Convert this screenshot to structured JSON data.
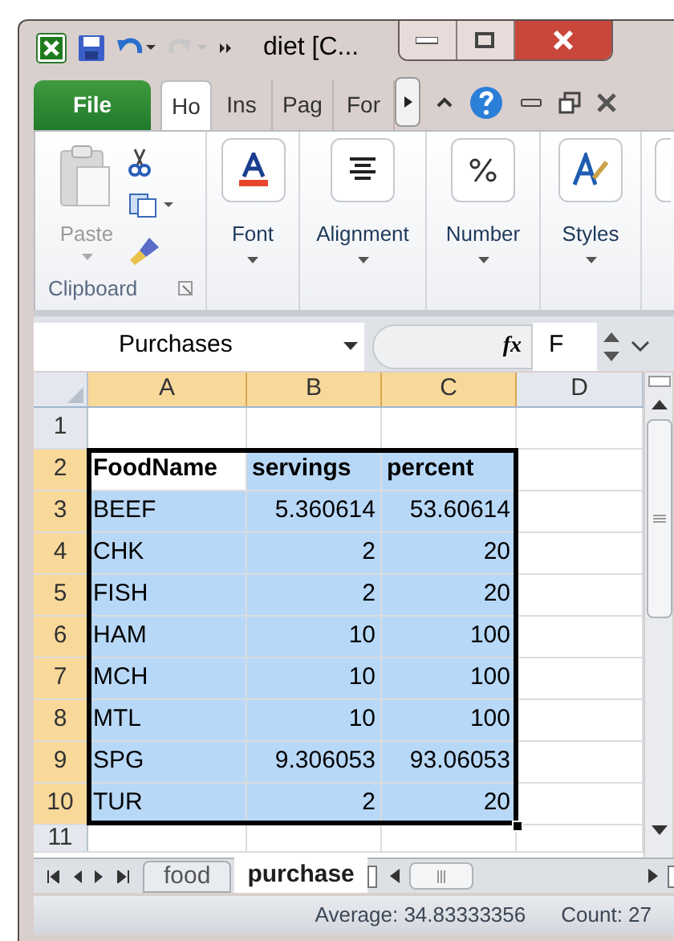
{
  "title_bar": {
    "title": "diet  [C..."
  },
  "ribbon_tabs": [
    {
      "label": "File",
      "kind": "file",
      "selected": false
    },
    {
      "label": "Ho",
      "kind": "tab",
      "selected": true
    },
    {
      "label": "Ins",
      "kind": "tab",
      "selected": false
    },
    {
      "label": "Pag",
      "kind": "tab",
      "selected": false
    },
    {
      "label": "For",
      "kind": "tab",
      "selected": false
    }
  ],
  "clipboard": {
    "paste": {
      "label": "Paste",
      "disabled": true
    },
    "group_label": "Clipboard"
  },
  "ribbon_groups": [
    {
      "label": "Font",
      "kind": "font"
    },
    {
      "label": "Alignment",
      "kind": "align"
    },
    {
      "label": "Number",
      "kind": "number"
    },
    {
      "label": "Styles",
      "kind": "styles"
    }
  ],
  "name_box": "Purchases",
  "function_button": "fx",
  "formula": "F",
  "columns": [
    {
      "label": "A",
      "selected": true
    },
    {
      "label": "B",
      "selected": true
    },
    {
      "label": "C",
      "selected": true
    },
    {
      "label": "D",
      "selected": false
    }
  ],
  "rows": [
    {
      "label": "1",
      "selected": false
    },
    {
      "label": "2",
      "selected": true,
      "kind": "header",
      "cells": [
        {
          "text": "FoodName",
          "selected": true,
          "active": true
        },
        {
          "text": "servings",
          "selected": true,
          "active": false
        },
        {
          "text": "percent",
          "selected": true,
          "active": false
        }
      ]
    },
    {
      "label": "3",
      "selected": true,
      "kind": "data",
      "cells": [
        {
          "text": "BEEF",
          "selected": true,
          "active": false
        },
        {
          "text": "5.360614",
          "selected": true,
          "active": false
        },
        {
          "text": "53.60614",
          "selected": true,
          "active": false
        }
      ]
    },
    {
      "label": "4",
      "selected": true,
      "kind": "data",
      "cells": [
        {
          "text": "CHK",
          "selected": true,
          "active": false
        },
        {
          "text": "2",
          "selected": true,
          "active": false
        },
        {
          "text": "20",
          "selected": true,
          "active": false
        }
      ]
    },
    {
      "label": "5",
      "selected": true,
      "kind": "data",
      "cells": [
        {
          "text": "FISH",
          "selected": true,
          "active": false
        },
        {
          "text": "2",
          "selected": true,
          "active": false
        },
        {
          "text": "20",
          "selected": true,
          "active": false
        }
      ]
    },
    {
      "label": "6",
      "selected": true,
      "kind": "data",
      "cells": [
        {
          "text": "HAM",
          "selected": true,
          "active": false
        },
        {
          "text": "10",
          "selected": true,
          "active": false
        },
        {
          "text": "100",
          "selected": true,
          "active": false
        }
      ]
    },
    {
      "label": "7",
      "selected": true,
      "kind": "data",
      "cells": [
        {
          "text": "MCH",
          "selected": true,
          "active": false
        },
        {
          "text": "10",
          "selected": true,
          "active": false
        },
        {
          "text": "100",
          "selected": true,
          "active": false
        }
      ]
    },
    {
      "label": "8",
      "selected": true,
      "kind": "data",
      "cells": [
        {
          "text": "MTL",
          "selected": true,
          "active": false
        },
        {
          "text": "10",
          "selected": true,
          "active": false
        },
        {
          "text": "100",
          "selected": true,
          "active": false
        }
      ]
    },
    {
      "label": "9",
      "selected": true,
      "kind": "data",
      "cells": [
        {
          "text": "SPG",
          "selected": true,
          "active": false
        },
        {
          "text": "9.306053",
          "selected": true,
          "active": false
        },
        {
          "text": "93.06053",
          "selected": true,
          "active": false
        }
      ]
    },
    {
      "label": "10",
      "selected": true,
      "kind": "data",
      "cells": [
        {
          "text": "TUR",
          "selected": true,
          "active": false
        },
        {
          "text": "2",
          "selected": true,
          "active": false
        },
        {
          "text": "20",
          "selected": true,
          "active": false
        }
      ]
    },
    {
      "label": "11",
      "selected": false
    }
  ],
  "sheet_tabs": [
    {
      "label": "food",
      "selected": false
    },
    {
      "label": "purchase",
      "selected": true
    }
  ],
  "status_bar": {
    "average": "Average: 34.83333356",
    "count": "Count: 27"
  }
}
